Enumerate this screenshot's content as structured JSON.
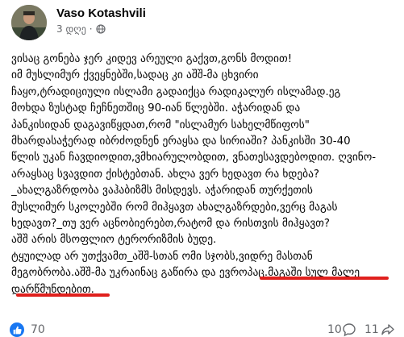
{
  "post": {
    "author": "Vaso Kotashvili",
    "time": "3 დღე",
    "separator": "·",
    "lines": [
      "ვისაც გონება ჯერ კიდევ არეული გაქვთ,გონს მოდით!",
      "   იმ მუსლიმურ ქვეყნებში,სადაც კი აშშ-მა ცხვირი",
      "ჩაყო,ტრადიციული ისლამი გადაიქცა რადიკალურ ისლამად.ეგ",
      "მოხდა ზუსტად ჩეჩნეთშიც 90-იან წლებში. აჭარიდან და",
      "პანკისიდან დაგავიწყდათ,რომ \"ისლამურ სახელმწიფოს\"",
      "მხარდასაჭერად იბრძოდნენ ერაყსა და სირიაში? პანკისში 30-40",
      "წლის უკან ჩავდიოდით,ვმხიარულობდით, ვნათესავდებოდით. ღვინო-",
      "არაყსაც სვავდით ქისტებთან. ახლა ვერ ხედავთ რა ხდება?",
      "_ახალგაზრდობა ვაჰაბიზმს მისდევს. აჭარიდან თურქეთის",
      "მუსლიმურ სკოლებში რომ მიჰყავთ ახალგაზრდები,ვერც მაგას",
      "ხედავთ?_თუ ვერ აცნობიერებთ,რატომ და რისთვის მიჰყავთ?",
      "აშშ არის მსოფლიო ტერორიზმის ბუდე.",
      "ტყუილად არ უთქვამთ_აშშ-სთან ომი სჯობს,ვიდრე მასთან",
      "მეგობრობა.აშშ-მა  უკრაინაც გაწირა და ევროპაც.მაგაში სულ მალე",
      "დარწმუნდებით."
    ]
  },
  "reactions": {
    "count": "70"
  },
  "stats": {
    "comments": "10",
    "shares": "11"
  },
  "colors": {
    "underline": "#e0201d",
    "like": "#1877f2",
    "meta": "#65676b"
  }
}
